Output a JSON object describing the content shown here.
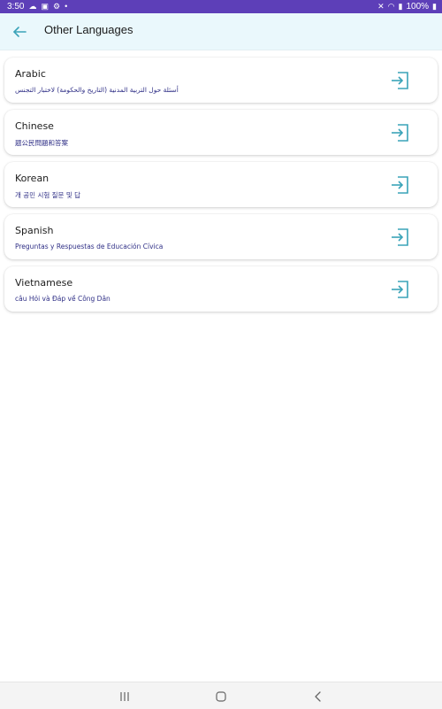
{
  "status_bar": {
    "time": "3:50",
    "battery": "100%",
    "left_icons": [
      "cloud-icon",
      "image-icon",
      "settings-icon",
      "dot-icon"
    ],
    "right_icons": [
      "mute-icon",
      "wifi-icon",
      "signal-icon",
      "battery-icon"
    ]
  },
  "app_bar": {
    "title": "Other Languages",
    "accent_color": "#3aa3b8"
  },
  "languages": [
    {
      "name": "Arabic",
      "subtitle": "أسئلة حول التربية المدنية (التاريخ والحكومة) لاختبار التجنس"
    },
    {
      "name": "Chinese",
      "subtitle": "题公民問題和答案"
    },
    {
      "name": "Korean",
      "subtitle": "개 공민 시험 질문 및 답"
    },
    {
      "name": "Spanish",
      "subtitle": "Preguntas y Respuestas de Educación Cívica"
    },
    {
      "name": "Vietnamese",
      "subtitle": "câu Hỏi và Đáp về Công Dân"
    }
  ],
  "nav_bar": {
    "icons": [
      "recent-apps-icon",
      "home-icon",
      "back-nav-icon"
    ]
  }
}
